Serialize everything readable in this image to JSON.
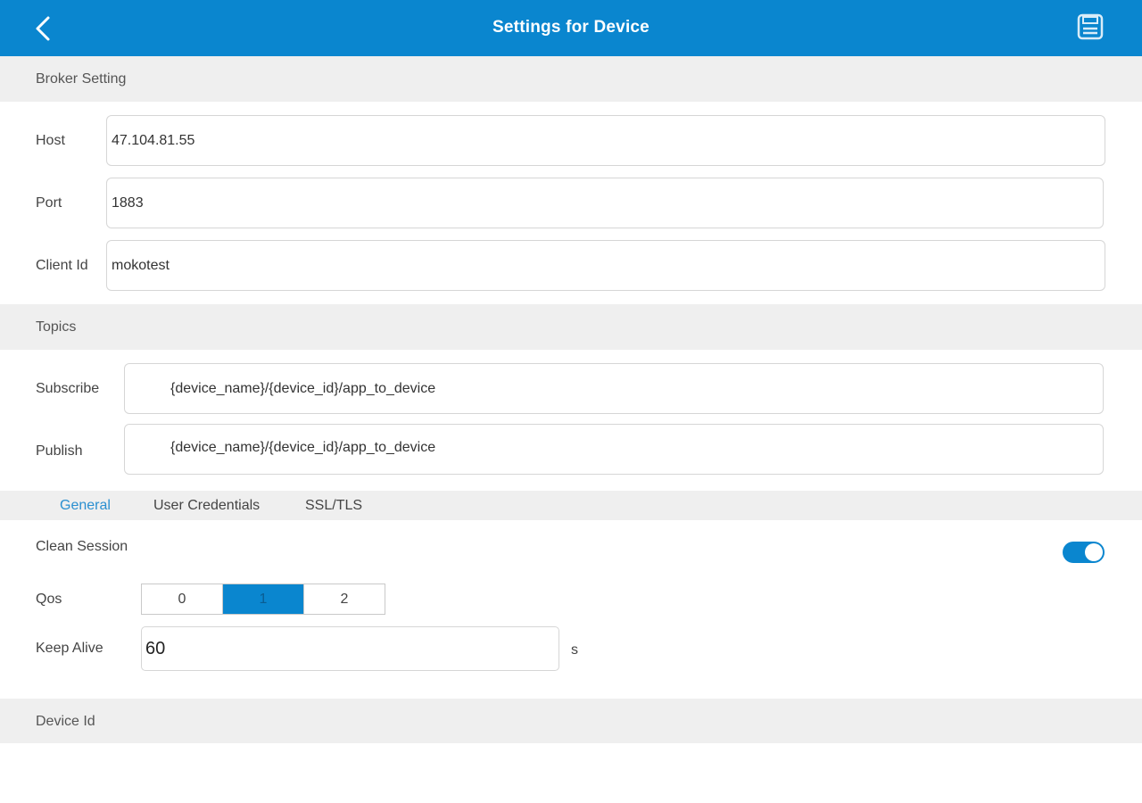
{
  "header": {
    "title": "Settings for Device",
    "back_icon": "chevron-left-icon",
    "save_icon": "save-icon"
  },
  "broker": {
    "section_title": "Broker Setting",
    "host_label": "Host",
    "host_value": "47.104.81.55",
    "port_label": "Port",
    "port_value": "1883",
    "client_id_label": "Client Id",
    "client_id_value": "mokotest"
  },
  "topics": {
    "section_title": "Topics",
    "subscribe_label": "Subscribe",
    "subscribe_value": "{device_name}/{device_id}/app_to_device",
    "publish_label": "Publish",
    "publish_value": "{device_name}/{device_id}/app_to_device"
  },
  "tabs": [
    {
      "label": "General",
      "active": true
    },
    {
      "label": "User Credentials",
      "active": false
    },
    {
      "label": "SSL/TLS",
      "active": false
    }
  ],
  "general": {
    "clean_session_label": "Clean Session",
    "clean_session_on": true,
    "qos_label": "Qos",
    "qos_options": [
      "0",
      "1",
      "2"
    ],
    "qos_selected": "1",
    "keep_alive_label": "Keep Alive",
    "keep_alive_value": "60",
    "keep_alive_unit": "s"
  },
  "device": {
    "section_title": "Device Id"
  },
  "colors": {
    "accent": "#0a86cf",
    "section_bg": "#efefef",
    "active_tab": "#2a8fd0"
  }
}
